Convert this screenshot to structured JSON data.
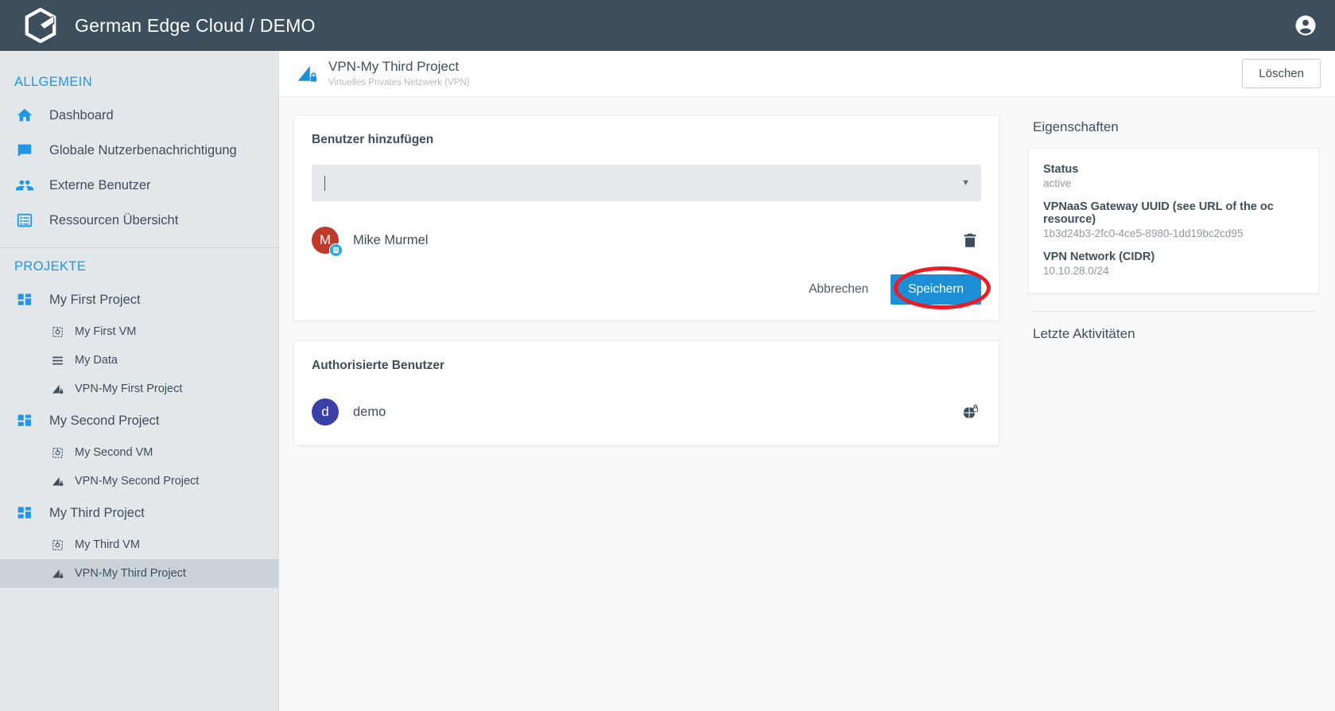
{
  "topbar": {
    "brand": "German Edge Cloud / DEMO",
    "logo_icon": "gec-logo-icon",
    "account_icon": "account-circle-icon"
  },
  "sidebar": {
    "groups": [
      {
        "title": "ALLGEMEIN",
        "items": [
          {
            "label": "Dashboard",
            "icon": "home-icon",
            "level": "top"
          },
          {
            "label": "Globale Nutzerbenachrichtigung",
            "icon": "chat-icon",
            "level": "top"
          },
          {
            "label": "Externe Benutzer",
            "icon": "people-icon",
            "level": "top"
          },
          {
            "label": "Ressourcen Übersicht",
            "icon": "list-board-icon",
            "level": "top"
          }
        ]
      },
      {
        "title": "PROJEKTE",
        "items": [
          {
            "label": "My First Project",
            "icon": "project-icon",
            "level": "project"
          },
          {
            "label": "My First VM",
            "icon": "vm-icon",
            "level": "sub"
          },
          {
            "label": "My Data",
            "icon": "data-list-icon",
            "level": "sub"
          },
          {
            "label": "VPN-My First Project",
            "icon": "vpn-icon",
            "level": "sub"
          },
          {
            "label": "My Second Project",
            "icon": "project-icon",
            "level": "project"
          },
          {
            "label": "My Second VM",
            "icon": "vm-icon",
            "level": "sub"
          },
          {
            "label": "VPN-My Second Project",
            "icon": "vpn-icon",
            "level": "sub"
          },
          {
            "label": "My Third Project",
            "icon": "project-icon",
            "level": "project"
          },
          {
            "label": "My Third VM",
            "icon": "vm-icon",
            "level": "sub"
          },
          {
            "label": "VPN-My Third Project",
            "icon": "vpn-icon",
            "level": "sub",
            "active": true
          }
        ]
      }
    ]
  },
  "page_header": {
    "icon": "vpn-icon",
    "title": "VPN-My Third Project",
    "subtitle": "Virtuelles Privates Netzwerk (VPN)",
    "delete_label": "Löschen"
  },
  "add_user_card": {
    "title": "Benutzer hinzufügen",
    "select_value": "",
    "select_placeholder": "",
    "dropdown_icon": "chevron-down-icon",
    "users": [
      {
        "name": "Mike Murmel",
        "initial": "M",
        "avatar_color": "#c0392b",
        "badge_icon": "organization-badge-icon",
        "action_icon": "trash-icon"
      }
    ],
    "cancel_label": "Abbrechen",
    "save_label": "Speichern",
    "annotation": "red-ellipse-highlight"
  },
  "authorized_users_card": {
    "title": "Authorisierte Benutzer",
    "users": [
      {
        "name": "demo",
        "initial": "d",
        "avatar_color": "#3b3fa8",
        "action_icon": "globe-lock-icon"
      }
    ]
  },
  "properties_panel": {
    "title": "Eigenschaften",
    "rows": [
      {
        "label": "Status",
        "value": "active"
      },
      {
        "label": "VPNaaS Gateway UUID (see URL of the oc resource)",
        "value": "1b3d24b3-2fc0-4ce5-8980-1dd19bc2cd95"
      },
      {
        "label": "VPN Network (CIDR)",
        "value": "10.10.28.0/24"
      }
    ],
    "activities_title": "Letzte Aktivitäten"
  },
  "colors": {
    "topbar": "#3d4f5d",
    "sidebar": "#e2e7ea",
    "accent_blue": "#2196e8",
    "primary_button": "#1c8fd6",
    "annotation_red": "#ee1b24",
    "text_dark": "#3d4f5d",
    "text_muted": "#8d99a5"
  }
}
